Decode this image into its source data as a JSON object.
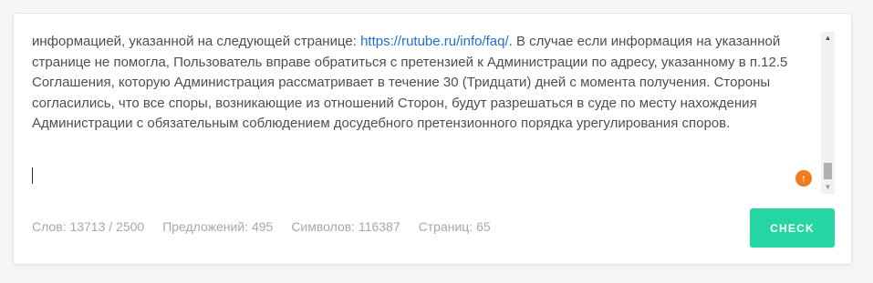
{
  "editor": {
    "text_before_link": "информацией, указанной на следующей странице: ",
    "link_text": "https://rutube.ru/info/faq/",
    "text_after_link": ". В случае если информация на указанной странице не помогла, Пользователь вправе обратиться с претензией к Администрации по адресу, указанному в п.12.5 Соглашения, которую Администрация рассматривает в течение 30 (Тридцати) дней с момента получения. Стороны согласились, что все споры, возникающие из отношений Сторон, будут разрешаться в суде по месту нахождения Администрации с обязательным соблюдением досудебного претензионного порядка урегулирования споров."
  },
  "scrollbar": {
    "up_arrow": "▲",
    "down_arrow": "▼"
  },
  "upload_badge": {
    "icon": "arrow-up-icon",
    "glyph": "↑",
    "color": "#f07c1b"
  },
  "stats": {
    "words": "Слов: 13713 / 2500",
    "sentences": "Предложений: 495",
    "characters": "Символов: 116387",
    "pages": "Страниц: 65"
  },
  "check_button": {
    "label": "CHECK",
    "color": "#26d6a2"
  }
}
